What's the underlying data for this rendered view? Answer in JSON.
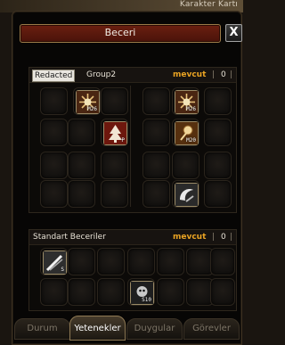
{
  "top_bar": {
    "text": "Karakter Kartı"
  },
  "window": {
    "title": "Beceri",
    "close_label": "X"
  },
  "skill_panel": {
    "tabs": [
      "Redacted",
      "Group2"
    ],
    "available_label": "mevcut",
    "separator": "|",
    "count": "0",
    "skills": [
      {
        "icon": "sunburst-skill-icon",
        "level": "M26",
        "accent": "#c9783a"
      },
      {
        "icon": "sunburst-skill-icon",
        "level": "M26",
        "accent": "#c9783a"
      },
      {
        "icon": "tree-skill-icon",
        "level": "P",
        "accent": "#8a1e12"
      },
      {
        "icon": "orb-skill-icon",
        "level": "M20",
        "accent": "#b46826"
      },
      {
        "icon": "crescent-skill-icon",
        "level": "",
        "accent": "#d0d0d0"
      }
    ]
  },
  "standard_panel": {
    "title": "Standart Beceriler",
    "available_label": "mevcut",
    "separator": "|",
    "count": "0",
    "skills": [
      {
        "icon": "slash-skill-icon",
        "level": "S",
        "accent": "#d0d0d0"
      },
      {
        "icon": "wolf-skill-icon",
        "level": "S10",
        "accent": "#9a9a9a"
      }
    ]
  },
  "bottom_tabs": [
    "Durum",
    "Yetenekler",
    "Duygular",
    "Görevler"
  ],
  "active_tab": "Yetenekler"
}
